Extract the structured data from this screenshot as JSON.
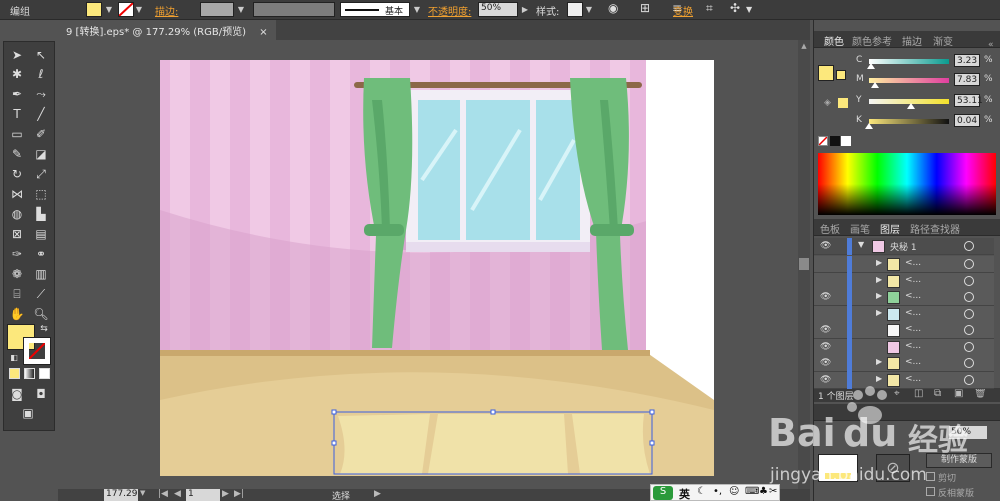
{
  "control_bar": {
    "mode_label": "编组",
    "fill_color": "#fce87c",
    "stroke_label": "描边:",
    "stroke_style_label": "基本",
    "opacity_label": "不透明度:",
    "opacity_value": "50%",
    "style_label": "样式:",
    "transform_label": "变换"
  },
  "document_tab": {
    "title": "9 [转换].eps* @ 177.29% (RGB/预览)",
    "close": "×"
  },
  "color_panel": {
    "tabs": [
      "颜色",
      "颜色参考",
      "描边",
      "渐变"
    ],
    "channels": [
      {
        "label": "C",
        "value": "3.23",
        "unit": "%",
        "fraction": 0.03
      },
      {
        "label": "M",
        "value": "7.83",
        "unit": "%",
        "fraction": 0.08
      },
      {
        "label": "Y",
        "value": "53.11",
        "unit": "%",
        "fraction": 0.53
      },
      {
        "label": "K",
        "value": "0.04",
        "unit": "%",
        "fraction": 0.0
      }
    ]
  },
  "layers_panel": {
    "tabs": [
      "色板",
      "画笔",
      "图层",
      "路径查找器"
    ],
    "layer_name": "央秘 1",
    "sublayer_label": "<...",
    "layer_count": "1 个图层"
  },
  "lower_panel": {
    "opacity_value": "50%",
    "make_mask_button": "制作蒙版",
    "clip_label": "剪切",
    "invert_mask_label": "反相蒙版"
  },
  "status_bar": {
    "zoom": "177.29",
    "page": "1",
    "tool": "选择"
  },
  "ime_bar": {
    "lang": "英"
  },
  "watermark": {
    "brand": "Bai",
    "suffix": "经验",
    "url": "jingyan.baidu.com"
  }
}
